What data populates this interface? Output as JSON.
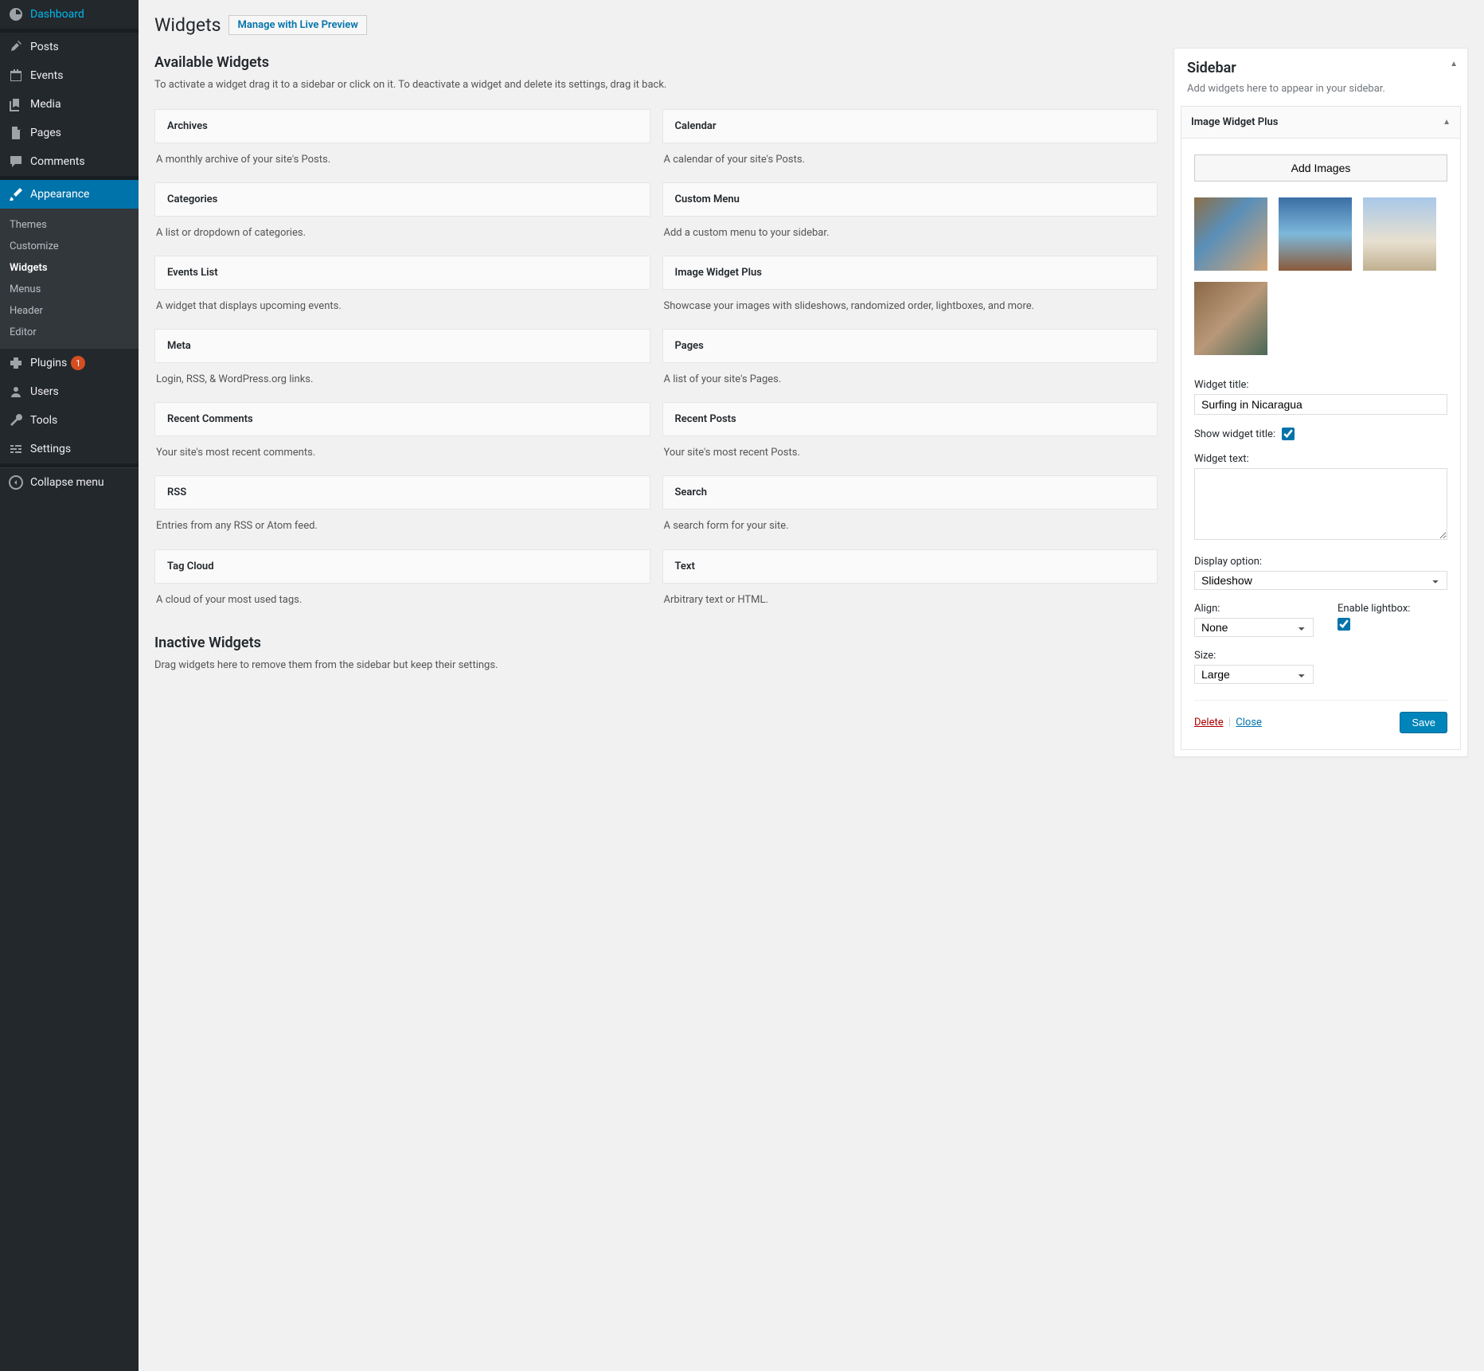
{
  "nav": {
    "dashboard": "Dashboard",
    "posts": "Posts",
    "events": "Events",
    "media": "Media",
    "pages": "Pages",
    "comments": "Comments",
    "appearance": "Appearance",
    "plugins": "Plugins",
    "plugins_badge": "1",
    "users": "Users",
    "tools": "Tools",
    "settings": "Settings",
    "collapse": "Collapse menu"
  },
  "subnav": {
    "themes": "Themes",
    "customize": "Customize",
    "widgets": "Widgets",
    "menus": "Menus",
    "header": "Header",
    "editor": "Editor"
  },
  "header": {
    "title": "Widgets",
    "action": "Manage with Live Preview"
  },
  "available": {
    "heading": "Available Widgets",
    "desc": "To activate a widget drag it to a sidebar or click on it. To deactivate a widget and delete its settings, drag it back."
  },
  "widgets": [
    {
      "name": "Archives",
      "desc": "A monthly archive of your site's Posts."
    },
    {
      "name": "Calendar",
      "desc": "A calendar of your site's Posts."
    },
    {
      "name": "Categories",
      "desc": "A list or dropdown of categories."
    },
    {
      "name": "Custom Menu",
      "desc": "Add a custom menu to your sidebar."
    },
    {
      "name": "Events List",
      "desc": "A widget that displays upcoming events."
    },
    {
      "name": "Image Widget Plus",
      "desc": "Showcase your images with slideshows, randomized order, lightboxes, and more."
    },
    {
      "name": "Meta",
      "desc": "Login, RSS, & WordPress.org links."
    },
    {
      "name": "Pages",
      "desc": "A list of your site's Pages."
    },
    {
      "name": "Recent Comments",
      "desc": "Your site's most recent comments."
    },
    {
      "name": "Recent Posts",
      "desc": "Your site's most recent Posts."
    },
    {
      "name": "RSS",
      "desc": "Entries from any RSS or Atom feed."
    },
    {
      "name": "Search",
      "desc": "A search form for your site."
    },
    {
      "name": "Tag Cloud",
      "desc": "A cloud of your most used tags."
    },
    {
      "name": "Text",
      "desc": "Arbitrary text or HTML."
    }
  ],
  "inactive": {
    "heading": "Inactive Widgets",
    "desc": "Drag widgets here to remove them from the sidebar but keep their settings."
  },
  "sidebar": {
    "title": "Sidebar",
    "desc": "Add widgets here to appear in your sidebar."
  },
  "instance": {
    "title": "Image Widget Plus",
    "add_images": "Add Images",
    "thumbs": [
      "linear-gradient(135deg,#8b6f47 0%,#5a8fb8 40%,#d4a574 100%)",
      "linear-gradient(180deg,#3a6ea5 0%,#7db8da 50%,#8a5a3a 100%)",
      "linear-gradient(180deg,#a8c8e8 0%,#e8e0d0 60%,#c0b090 100%)",
      "linear-gradient(135deg,#8a6848 0%,#b89878 50%,#4a6858 100%)"
    ],
    "widget_title_label": "Widget title:",
    "widget_title_value": "Surfing in Nicaragua",
    "show_title_label": "Show widget title:",
    "show_title_checked": true,
    "widget_text_label": "Widget text:",
    "widget_text_value": "",
    "display_label": "Display option:",
    "display_value": "Slideshow",
    "align_label": "Align:",
    "align_value": "None",
    "lightbox_label": "Enable lightbox:",
    "lightbox_checked": true,
    "size_label": "Size:",
    "size_value": "Large",
    "delete": "Delete",
    "close": "Close",
    "save": "Save"
  }
}
